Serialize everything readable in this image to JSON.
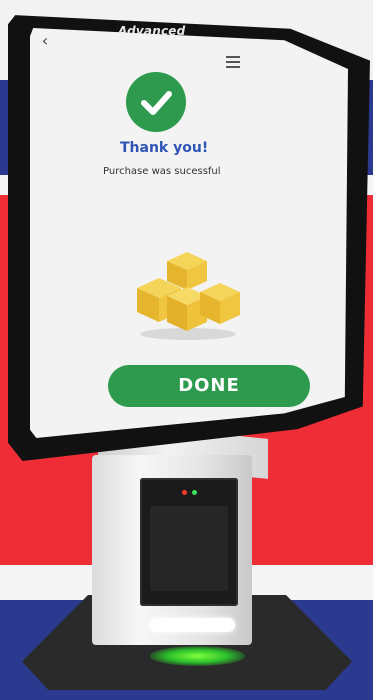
{
  "device": {
    "brand": "Advanced"
  },
  "screen": {
    "title": "Thank you!",
    "message": "Purchase was sucessful",
    "done_label": "DONE",
    "back_icon": "chevron-left-icon",
    "menu_icon": "hamburger-menu-icon",
    "status_icon": "checkmark-icon"
  },
  "colors": {
    "accent_green": "#2e9a4e",
    "title_blue": "#2e55b5",
    "flag_blue": "#2b3a8f",
    "flag_red": "#ee2d36"
  }
}
